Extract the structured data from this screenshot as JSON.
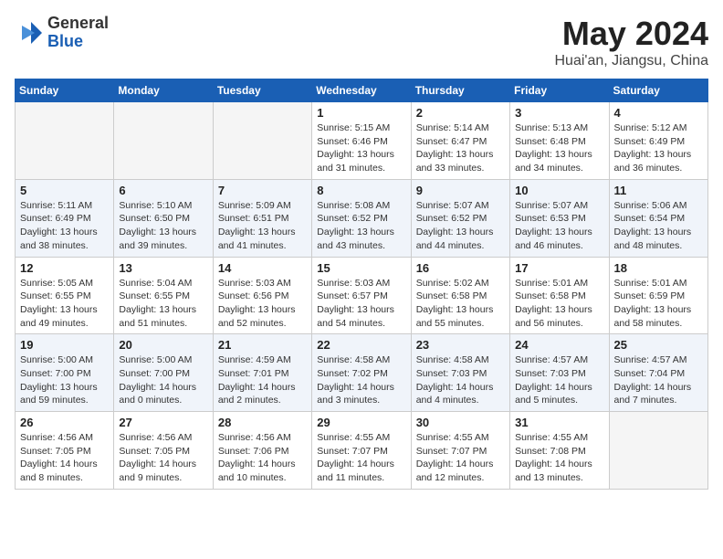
{
  "header": {
    "logo": {
      "line1": "General",
      "line2": "Blue"
    },
    "title": "May 2024",
    "subtitle": "Huai'an, Jiangsu, China"
  },
  "days_of_week": [
    "Sunday",
    "Monday",
    "Tuesday",
    "Wednesday",
    "Thursday",
    "Friday",
    "Saturday"
  ],
  "weeks": [
    [
      {
        "day": "",
        "info": ""
      },
      {
        "day": "",
        "info": ""
      },
      {
        "day": "",
        "info": ""
      },
      {
        "day": "1",
        "info": "Sunrise: 5:15 AM\nSunset: 6:46 PM\nDaylight: 13 hours\nand 31 minutes."
      },
      {
        "day": "2",
        "info": "Sunrise: 5:14 AM\nSunset: 6:47 PM\nDaylight: 13 hours\nand 33 minutes."
      },
      {
        "day": "3",
        "info": "Sunrise: 5:13 AM\nSunset: 6:48 PM\nDaylight: 13 hours\nand 34 minutes."
      },
      {
        "day": "4",
        "info": "Sunrise: 5:12 AM\nSunset: 6:49 PM\nDaylight: 13 hours\nand 36 minutes."
      }
    ],
    [
      {
        "day": "5",
        "info": "Sunrise: 5:11 AM\nSunset: 6:49 PM\nDaylight: 13 hours\nand 38 minutes."
      },
      {
        "day": "6",
        "info": "Sunrise: 5:10 AM\nSunset: 6:50 PM\nDaylight: 13 hours\nand 39 minutes."
      },
      {
        "day": "7",
        "info": "Sunrise: 5:09 AM\nSunset: 6:51 PM\nDaylight: 13 hours\nand 41 minutes."
      },
      {
        "day": "8",
        "info": "Sunrise: 5:08 AM\nSunset: 6:52 PM\nDaylight: 13 hours\nand 43 minutes."
      },
      {
        "day": "9",
        "info": "Sunrise: 5:07 AM\nSunset: 6:52 PM\nDaylight: 13 hours\nand 44 minutes."
      },
      {
        "day": "10",
        "info": "Sunrise: 5:07 AM\nSunset: 6:53 PM\nDaylight: 13 hours\nand 46 minutes."
      },
      {
        "day": "11",
        "info": "Sunrise: 5:06 AM\nSunset: 6:54 PM\nDaylight: 13 hours\nand 48 minutes."
      }
    ],
    [
      {
        "day": "12",
        "info": "Sunrise: 5:05 AM\nSunset: 6:55 PM\nDaylight: 13 hours\nand 49 minutes."
      },
      {
        "day": "13",
        "info": "Sunrise: 5:04 AM\nSunset: 6:55 PM\nDaylight: 13 hours\nand 51 minutes."
      },
      {
        "day": "14",
        "info": "Sunrise: 5:03 AM\nSunset: 6:56 PM\nDaylight: 13 hours\nand 52 minutes."
      },
      {
        "day": "15",
        "info": "Sunrise: 5:03 AM\nSunset: 6:57 PM\nDaylight: 13 hours\nand 54 minutes."
      },
      {
        "day": "16",
        "info": "Sunrise: 5:02 AM\nSunset: 6:58 PM\nDaylight: 13 hours\nand 55 minutes."
      },
      {
        "day": "17",
        "info": "Sunrise: 5:01 AM\nSunset: 6:58 PM\nDaylight: 13 hours\nand 56 minutes."
      },
      {
        "day": "18",
        "info": "Sunrise: 5:01 AM\nSunset: 6:59 PM\nDaylight: 13 hours\nand 58 minutes."
      }
    ],
    [
      {
        "day": "19",
        "info": "Sunrise: 5:00 AM\nSunset: 7:00 PM\nDaylight: 13 hours\nand 59 minutes."
      },
      {
        "day": "20",
        "info": "Sunrise: 5:00 AM\nSunset: 7:00 PM\nDaylight: 14 hours\nand 0 minutes."
      },
      {
        "day": "21",
        "info": "Sunrise: 4:59 AM\nSunset: 7:01 PM\nDaylight: 14 hours\nand 2 minutes."
      },
      {
        "day": "22",
        "info": "Sunrise: 4:58 AM\nSunset: 7:02 PM\nDaylight: 14 hours\nand 3 minutes."
      },
      {
        "day": "23",
        "info": "Sunrise: 4:58 AM\nSunset: 7:03 PM\nDaylight: 14 hours\nand 4 minutes."
      },
      {
        "day": "24",
        "info": "Sunrise: 4:57 AM\nSunset: 7:03 PM\nDaylight: 14 hours\nand 5 minutes."
      },
      {
        "day": "25",
        "info": "Sunrise: 4:57 AM\nSunset: 7:04 PM\nDaylight: 14 hours\nand 7 minutes."
      }
    ],
    [
      {
        "day": "26",
        "info": "Sunrise: 4:56 AM\nSunset: 7:05 PM\nDaylight: 14 hours\nand 8 minutes."
      },
      {
        "day": "27",
        "info": "Sunrise: 4:56 AM\nSunset: 7:05 PM\nDaylight: 14 hours\nand 9 minutes."
      },
      {
        "day": "28",
        "info": "Sunrise: 4:56 AM\nSunset: 7:06 PM\nDaylight: 14 hours\nand 10 minutes."
      },
      {
        "day": "29",
        "info": "Sunrise: 4:55 AM\nSunset: 7:07 PM\nDaylight: 14 hours\nand 11 minutes."
      },
      {
        "day": "30",
        "info": "Sunrise: 4:55 AM\nSunset: 7:07 PM\nDaylight: 14 hours\nand 12 minutes."
      },
      {
        "day": "31",
        "info": "Sunrise: 4:55 AM\nSunset: 7:08 PM\nDaylight: 14 hours\nand 13 minutes."
      },
      {
        "day": "",
        "info": ""
      }
    ]
  ]
}
